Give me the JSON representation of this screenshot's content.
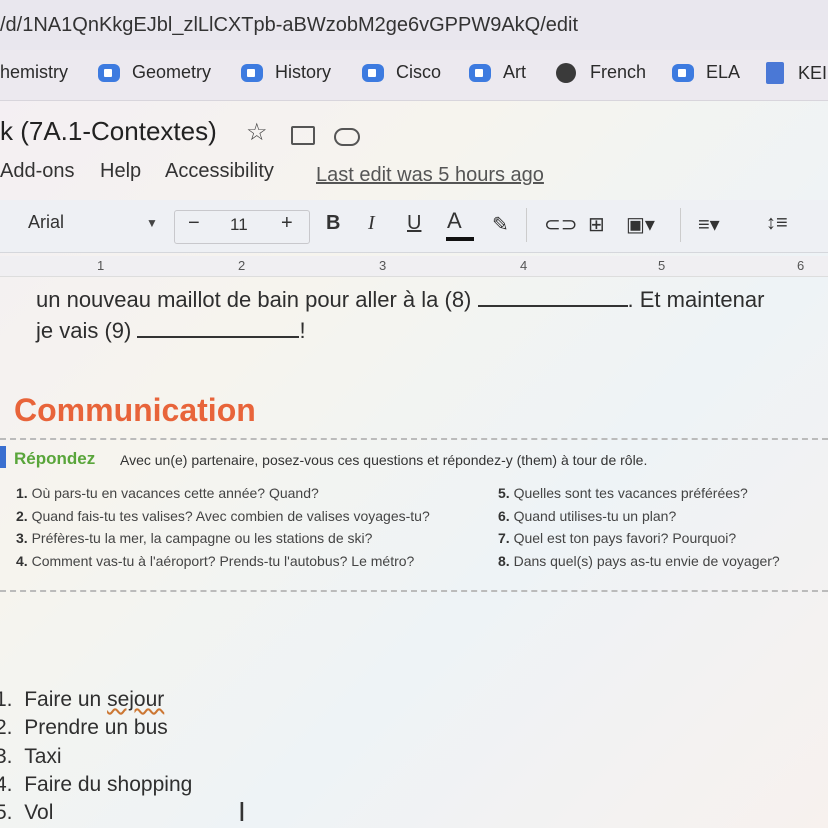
{
  "browser": {
    "url": "/d/1NA1QnKkgEJbl_zlLlCXTpb-aBWzobM2ge6vGPPW9AkQ/edit",
    "bookmarks": [
      {
        "label": "hemistry",
        "icon": "none"
      },
      {
        "label": "Geometry",
        "icon": "meet-icon"
      },
      {
        "label": "History",
        "icon": "meet-icon"
      },
      {
        "label": "Cisco",
        "icon": "meet-icon"
      },
      {
        "label": "Art",
        "icon": "meet-icon"
      },
      {
        "label": "French",
        "icon": "globe-icon"
      },
      {
        "label": "ELA",
        "icon": "meet-icon"
      },
      {
        "label": "KEI",
        "icon": "docs-icon"
      }
    ]
  },
  "doc": {
    "title": "k (7A.1-Contextes)",
    "menu": [
      "Add-ons",
      "Help",
      "Accessibility"
    ],
    "last_edit": "Last edit was 5 hours ago"
  },
  "toolbar": {
    "font": "Arial",
    "font_size": "11",
    "minus": "−",
    "plus": "+",
    "bold": "B",
    "italic": "I",
    "underline": "U",
    "text_color": "A"
  },
  "ruler": [
    "1",
    "2",
    "3",
    "4",
    "5",
    "6"
  ],
  "body": {
    "line1_a": "un nouveau maillot de bain pour aller à la (8)",
    "line1_b": ". Et maintenar",
    "line2_a": "je vais (9)",
    "line2_b": "!",
    "section_title": "Communication",
    "repondez": "Répondez",
    "instructions": "Avec un(e) partenaire, posez-vous ces questions et répondez-y (them) à tour de rôle.",
    "questions_left": [
      {
        "num": "1.",
        "text": "Où pars-tu en vacances cette année? Quand?"
      },
      {
        "num": "2.",
        "text": "Quand fais-tu tes valises? Avec combien de valises voyages-tu?"
      },
      {
        "num": "3.",
        "text": "Préfères-tu la mer, la campagne ou les stations de ski?"
      },
      {
        "num": "4.",
        "text": "Comment vas-tu à l'aéroport? Prends-tu l'autobus? Le métro?"
      }
    ],
    "questions_right": [
      {
        "num": "5.",
        "text": "Quelles sont tes vacances préférées?"
      },
      {
        "num": "6.",
        "text": "Quand utilises-tu un plan?"
      },
      {
        "num": "7.",
        "text": "Quel est ton pays favori? Pourquoi?"
      },
      {
        "num": "8.",
        "text": "Dans quel(s) pays as-tu envie de voyager?"
      }
    ],
    "answers": [
      {
        "num": "1.",
        "text_a": "Faire un ",
        "text_b": "sejour"
      },
      {
        "num": "2.",
        "text_a": "Prendre un bus",
        "text_b": ""
      },
      {
        "num": "3.",
        "text_a": "Taxi",
        "text_b": ""
      },
      {
        "num": "4.",
        "text_a": "Faire du shopping",
        "text_b": ""
      },
      {
        "num": "5.",
        "text_a": "Vol",
        "text_b": ""
      }
    ]
  }
}
